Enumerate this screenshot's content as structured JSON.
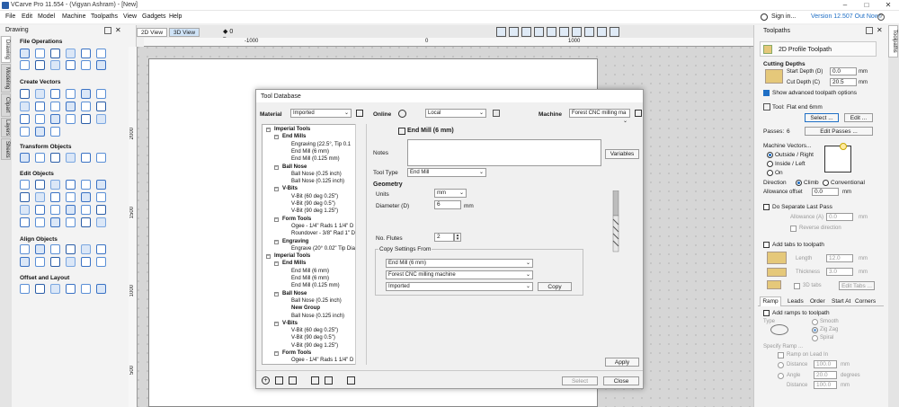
{
  "app": {
    "title": "VCarve Pro 11.554 - (Vigyan Ashram) - [New]"
  },
  "menu": [
    "File",
    "Edit",
    "Model",
    "Machine",
    "Toolpaths",
    "View",
    "Gadgets",
    "Help"
  ],
  "header": {
    "signin": "Sign in...",
    "version": "Version 12.507 Out Now!"
  },
  "left": {
    "title": "Drawing",
    "tabs": [
      "Drawing",
      "Modeling",
      "Clipart",
      "Layers",
      "Sheets"
    ],
    "sections": [
      "File Operations",
      "Create Vectors",
      "Transform Objects",
      "Edit Objects",
      "Align Objects",
      "Offset and Layout"
    ]
  },
  "view": {
    "tab2d": "2D View",
    "tab3d": "3D View",
    "ruler_top": [
      "-1000",
      "0",
      "1000"
    ],
    "ruler_left": [
      "2000",
      "1500",
      "1000",
      "500"
    ]
  },
  "right": {
    "title": "Toolpaths",
    "tab": "Toolpaths",
    "profile_title": "2D Profile Toolpath",
    "cutting_depths": "Cutting Depths",
    "start_depth_label": "Start Depth (D)",
    "start_depth": "0.0",
    "cut_depth_label": "Cut Depth (C)",
    "cut_depth": "20.5",
    "unit": "mm",
    "show_adv": "Show advanced toolpath options",
    "tool_label": "Tool:",
    "tool_name": "Flat end 6mm",
    "select_btn": "Select ...",
    "edit_btn": "Edit ...",
    "passes_label": "Passes:",
    "passes": "6",
    "edit_passes": "Edit Passes ...",
    "machine_vectors": "Machine Vectors...",
    "outside": "Outside / Right",
    "inside": "Inside / Left",
    "on": "On",
    "direction": "Direction",
    "climb": "Climb",
    "conventional": "Conventional",
    "allow_offset": "Allowance offset",
    "allow_value": "0.0",
    "separate_pass": "Do Separate Last Pass",
    "allowance_label": "Allowance (A)",
    "allowance_val": "0.0",
    "reverse": "Reverse direction",
    "add_tabs": "Add tabs to toolpath",
    "length_label": "Length",
    "length_val": "12.0",
    "thick_label": "Thickness",
    "thick_val": "3.0",
    "tabs3d": "3D tabs",
    "edit_tabs": "Edit Tabs ...",
    "subtabs": [
      "Ramp",
      "Leads",
      "Order",
      "Start At",
      "Corners"
    ],
    "add_ramps": "Add ramps to toolpath",
    "type": "Type",
    "smooth": "Smooth",
    "zigzag": "Zig Zag",
    "spiral": "Spiral",
    "specify_ramp": "Specify Ramp ...",
    "ramp_lead": "Ramp on Lead In",
    "distance": "Distance",
    "distance_val": "100.0",
    "angle": "Angle",
    "angle_val": "20.0",
    "degrees": "degrees",
    "distance2_val": "100.0"
  },
  "dialog": {
    "title": "Tool Database",
    "material_label": "Material",
    "material": "Imported",
    "online_label": "Online",
    "online": "Local",
    "machine_label": "Machine",
    "machine": "Forest CNC milling ma",
    "tree": [
      {
        "t": "Imperial Tools",
        "lvl": 0,
        "b": true,
        "bx": "−"
      },
      {
        "t": "End Mills",
        "lvl": 1,
        "b": true,
        "bx": "−"
      },
      {
        "t": "Engraving (22.5°, Tip 0.1",
        "lvl": 2
      },
      {
        "t": "End Mill (6 mm)",
        "lvl": 2
      },
      {
        "t": "End Mill (0.125 mm)",
        "lvl": 2
      },
      {
        "t": "Ball Nose",
        "lvl": 1,
        "b": true,
        "bx": "−"
      },
      {
        "t": "Ball Nose (0.25 inch)",
        "lvl": 2
      },
      {
        "t": "Ball Nose (0.125 inch)",
        "lvl": 2
      },
      {
        "t": "V-Bits",
        "lvl": 1,
        "b": true,
        "bx": "−"
      },
      {
        "t": "V-Bit (60 deg 0.25\")",
        "lvl": 2
      },
      {
        "t": "V-Bit (90 deg 0.5\")",
        "lvl": 2
      },
      {
        "t": "V-Bit (90 deg 1.25\")",
        "lvl": 2
      },
      {
        "t": "Form Tools",
        "lvl": 1,
        "b": true,
        "bx": "−"
      },
      {
        "t": "Ogee - 1/4\" Rads 1 1/4\" D",
        "lvl": 2
      },
      {
        "t": "Roundover - 3/8\" Rad 1\" D",
        "lvl": 2
      },
      {
        "t": "Engraving",
        "lvl": 1,
        "b": true,
        "bx": "−"
      },
      {
        "t": "Engrave (20° 0.02\" Tip Dia",
        "lvl": 2
      },
      {
        "t": "Imperial Tools",
        "lvl": 0,
        "b": true,
        "bx": "−"
      },
      {
        "t": "End Mills",
        "lvl": 1,
        "b": true,
        "bx": "−"
      },
      {
        "t": "End Mill (6 mm)",
        "lvl": 2
      },
      {
        "t": "End Mill (6 mm)",
        "lvl": 2
      },
      {
        "t": "End Mill (0.125 mm)",
        "lvl": 2
      },
      {
        "t": "Ball Nose",
        "lvl": 1,
        "b": true,
        "bx": "−"
      },
      {
        "t": "Ball Nose (0.25 inch)",
        "lvl": 2
      },
      {
        "t": "New Group",
        "lvl": 2,
        "b": true
      },
      {
        "t": "Ball Nose (0.125 inch)",
        "lvl": 2
      },
      {
        "t": "V-Bits",
        "lvl": 1,
        "b": true,
        "bx": "−"
      },
      {
        "t": "V-Bit (60 deg 0.25\")",
        "lvl": 2
      },
      {
        "t": "V-Bit (90 deg 0.5\")",
        "lvl": 2
      },
      {
        "t": "V-Bit (90 deg 1.25\")",
        "lvl": 2
      },
      {
        "t": "Form Tools",
        "lvl": 1,
        "b": true,
        "bx": "−"
      },
      {
        "t": "Ogee - 1/4\" Rads 1 1/4\" D",
        "lvl": 2
      }
    ],
    "tool_title": "End Mill (6 mm)",
    "notes_label": "Notes",
    "variables_btn": "Variables",
    "tooltype_label": "Tool Type",
    "tooltype": "End Mill",
    "geometry": "Geometry",
    "units_label": "Units",
    "units": "mm",
    "diameter_label": "Diameter (D)",
    "diameter": "6",
    "diameter_unit": "mm",
    "flutes_label": "No. Flutes",
    "flutes": "2",
    "copy_from": "Copy Settings From",
    "copy_tool": "End Mill (6 mm)",
    "copy_machine": "Forest CNC milling machine",
    "copy_material": "Imported",
    "copy_btn": "Copy",
    "apply_btn": "Apply",
    "select_btn": "Select",
    "close_btn": "Close"
  }
}
